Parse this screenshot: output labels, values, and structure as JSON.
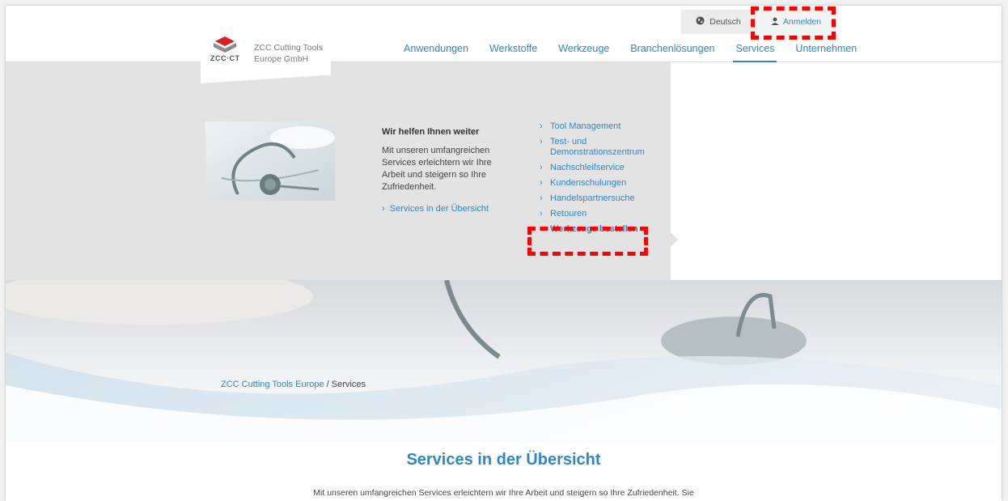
{
  "header": {
    "logo": {
      "company_line1": "ZCC Cutting Tools",
      "company_line2": "Europe GmbH",
      "mark_text": "ZCC·CT",
      "brand_red": "#d5232a",
      "brand_grey": "#8b8b8b"
    },
    "language": {
      "label": "Deutsch",
      "icon": "globe-icon"
    },
    "login": {
      "label": "Anmelden",
      "icon": "user-icon"
    },
    "nav": [
      {
        "label": "Anwendungen",
        "active": false
      },
      {
        "label": "Werkstoffe",
        "active": false
      },
      {
        "label": "Werkzeuge",
        "active": false
      },
      {
        "label": "Branchenlösungen",
        "active": false
      },
      {
        "label": "Services",
        "active": true
      },
      {
        "label": "Unternehmen",
        "active": false
      }
    ]
  },
  "mega_menu": {
    "intro_title": "Wir helfen Ihnen weiter",
    "intro_text": "Mit unseren umfangreichen Services erleichtern wir Ihre Arbeit und steigern so Ihre Zufriedenheit.",
    "overview_link": "Services in der Übersicht",
    "services": [
      {
        "label": "Tool Management"
      },
      {
        "label": "Test- und Demonstrationszentrum"
      },
      {
        "label": "Nachschleifservice"
      },
      {
        "label": "Kundenschulungen"
      },
      {
        "label": "Handelspartnersuche"
      },
      {
        "label": "Retouren"
      },
      {
        "label": "Werkzeuge bestellen",
        "bold": true
      }
    ]
  },
  "breadcrumb": {
    "home": "ZCC Cutting Tools Europe",
    "separator": " / ",
    "current": "Services"
  },
  "content": {
    "title": "Services in der Übersicht",
    "text": "Mit unseren umfangreichen Services erleichtern wir Ihre Arbeit und steigern so Ihre Zufriedenheit. Sie"
  },
  "colors": {
    "accent": "#2f87c5",
    "menu_bg": "#e3e3e3",
    "annotation": "#ff0000"
  }
}
